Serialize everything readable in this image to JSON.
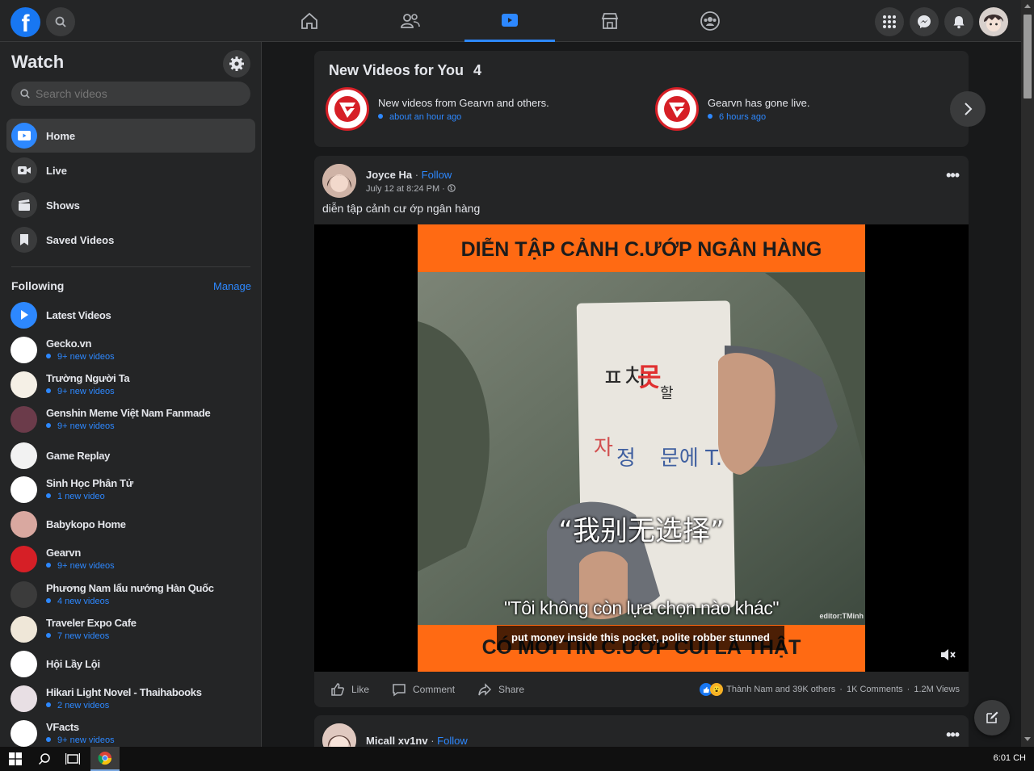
{
  "topbar": {
    "logo": "f",
    "nav": [
      {
        "name": "home-icon"
      },
      {
        "name": "friends-icon"
      },
      {
        "name": "watch-icon",
        "active": true
      },
      {
        "name": "marketplace-icon"
      },
      {
        "name": "groups-icon"
      }
    ],
    "right": [
      "menu-grid-icon",
      "messenger-icon",
      "notifications-icon",
      "profile-avatar"
    ]
  },
  "sidebar": {
    "title": "Watch",
    "search_placeholder": "Search videos",
    "menu": [
      {
        "label": "Home",
        "icon": "play-icon",
        "active": true
      },
      {
        "label": "Live",
        "icon": "live-camera-icon"
      },
      {
        "label": "Shows",
        "icon": "clapperboard-icon"
      },
      {
        "label": "Saved Videos",
        "icon": "bookmark-icon"
      }
    ],
    "following_label": "Following",
    "manage_label": "Manage",
    "following": [
      {
        "name": "Latest Videos",
        "sub": "",
        "color": "#2d88ff"
      },
      {
        "name": "Gecko.vn",
        "sub": "9+ new videos",
        "color": "#ffffff"
      },
      {
        "name": "Trường Người Ta",
        "sub": "9+ new videos",
        "color": "#f5f0e6"
      },
      {
        "name": "Genshin Meme Việt Nam Fanmade",
        "sub": "9+ new videos",
        "color": "#6b3b4a"
      },
      {
        "name": "Game Replay",
        "sub": "",
        "color": "#f2f2f2"
      },
      {
        "name": "Sinh Học Phân Tử",
        "sub": "1 new video",
        "color": "#ffffff"
      },
      {
        "name": "Babykopo Home",
        "sub": "",
        "color": "#d9a8a0"
      },
      {
        "name": "Gearvn",
        "sub": "9+ new videos",
        "color": "#d61f26"
      },
      {
        "name": "Phương Nam lẩu nướng Hàn Quốc",
        "sub": "4 new videos",
        "color": "#3b3b3b"
      },
      {
        "name": "Traveler Expo Cafe",
        "sub": "7 new videos",
        "color": "#efe7d8"
      },
      {
        "name": "Hội Lầy Lội",
        "sub": "",
        "color": "#ffffff"
      },
      {
        "name": "Hikari Light Novel - Thaihabooks",
        "sub": "2 new videos",
        "color": "#e8dfe4"
      },
      {
        "name": "VFacts",
        "sub": "9+ new videos",
        "color": "#ffffff"
      }
    ]
  },
  "new_videos": {
    "title": "New Videos for You",
    "count": "4",
    "items": [
      {
        "text": "New videos from Gearvn and others.",
        "time": "about an hour ago"
      },
      {
        "text": "Gearvn has gone live.",
        "time": "6 hours ago"
      }
    ]
  },
  "post": {
    "author": "Joyce Ha",
    "separator": " · ",
    "follow": "Follow",
    "date": "July 12 at 8:24 PM · ",
    "caption": "diễn tập cảnh cư ớp ngân hàng",
    "video": {
      "banner_top": "DIỄN TẬP CẢNH C.ƯỚP NGÂN HÀNG",
      "banner_bottom": "CÓ MỚI TIN C.ƯỚP CỦI LÀ THẬT",
      "subtitle": "\"Tôi không còn lựa chọn nào khác\"",
      "caption": "put money inside this pocket, polite robber stunned",
      "chinese": "“我别无选择”",
      "editor": "editor:TMinh"
    },
    "actions": {
      "like": "Like",
      "comment": "Comment",
      "share": "Share"
    },
    "reactions": "Thành Nam and 39K others",
    "comments": "1K Comments",
    "views": "1.2M Views"
  },
  "post2": {
    "author": "Micall xv1nv",
    "separator": " · ",
    "follow": "Follow"
  },
  "taskbar": {
    "time": "6:01 CH"
  }
}
